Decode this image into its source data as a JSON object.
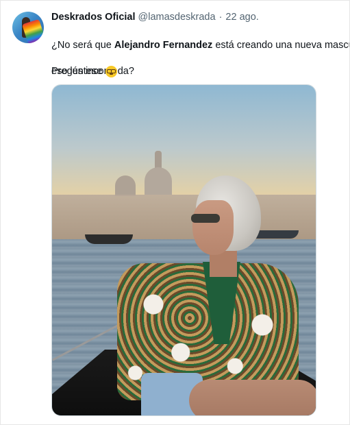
{
  "tweet": {
    "author_name": "Deskrados Oficial",
    "author_handle": "@lamasdeskrada",
    "separator": "·",
    "timestamp": "22 ago.",
    "text_line1_prefix": "¿No será que ",
    "text_line1_bold": "Alejandro Fernandez",
    "text_line1_suffix": " está creando una nueva masculin",
    "text_line2": "eso les incomoda?",
    "text_line3": "Pregúntese",
    "emoji": "nerd-face-emoji"
  },
  "media": {
    "type": "photo"
  }
}
